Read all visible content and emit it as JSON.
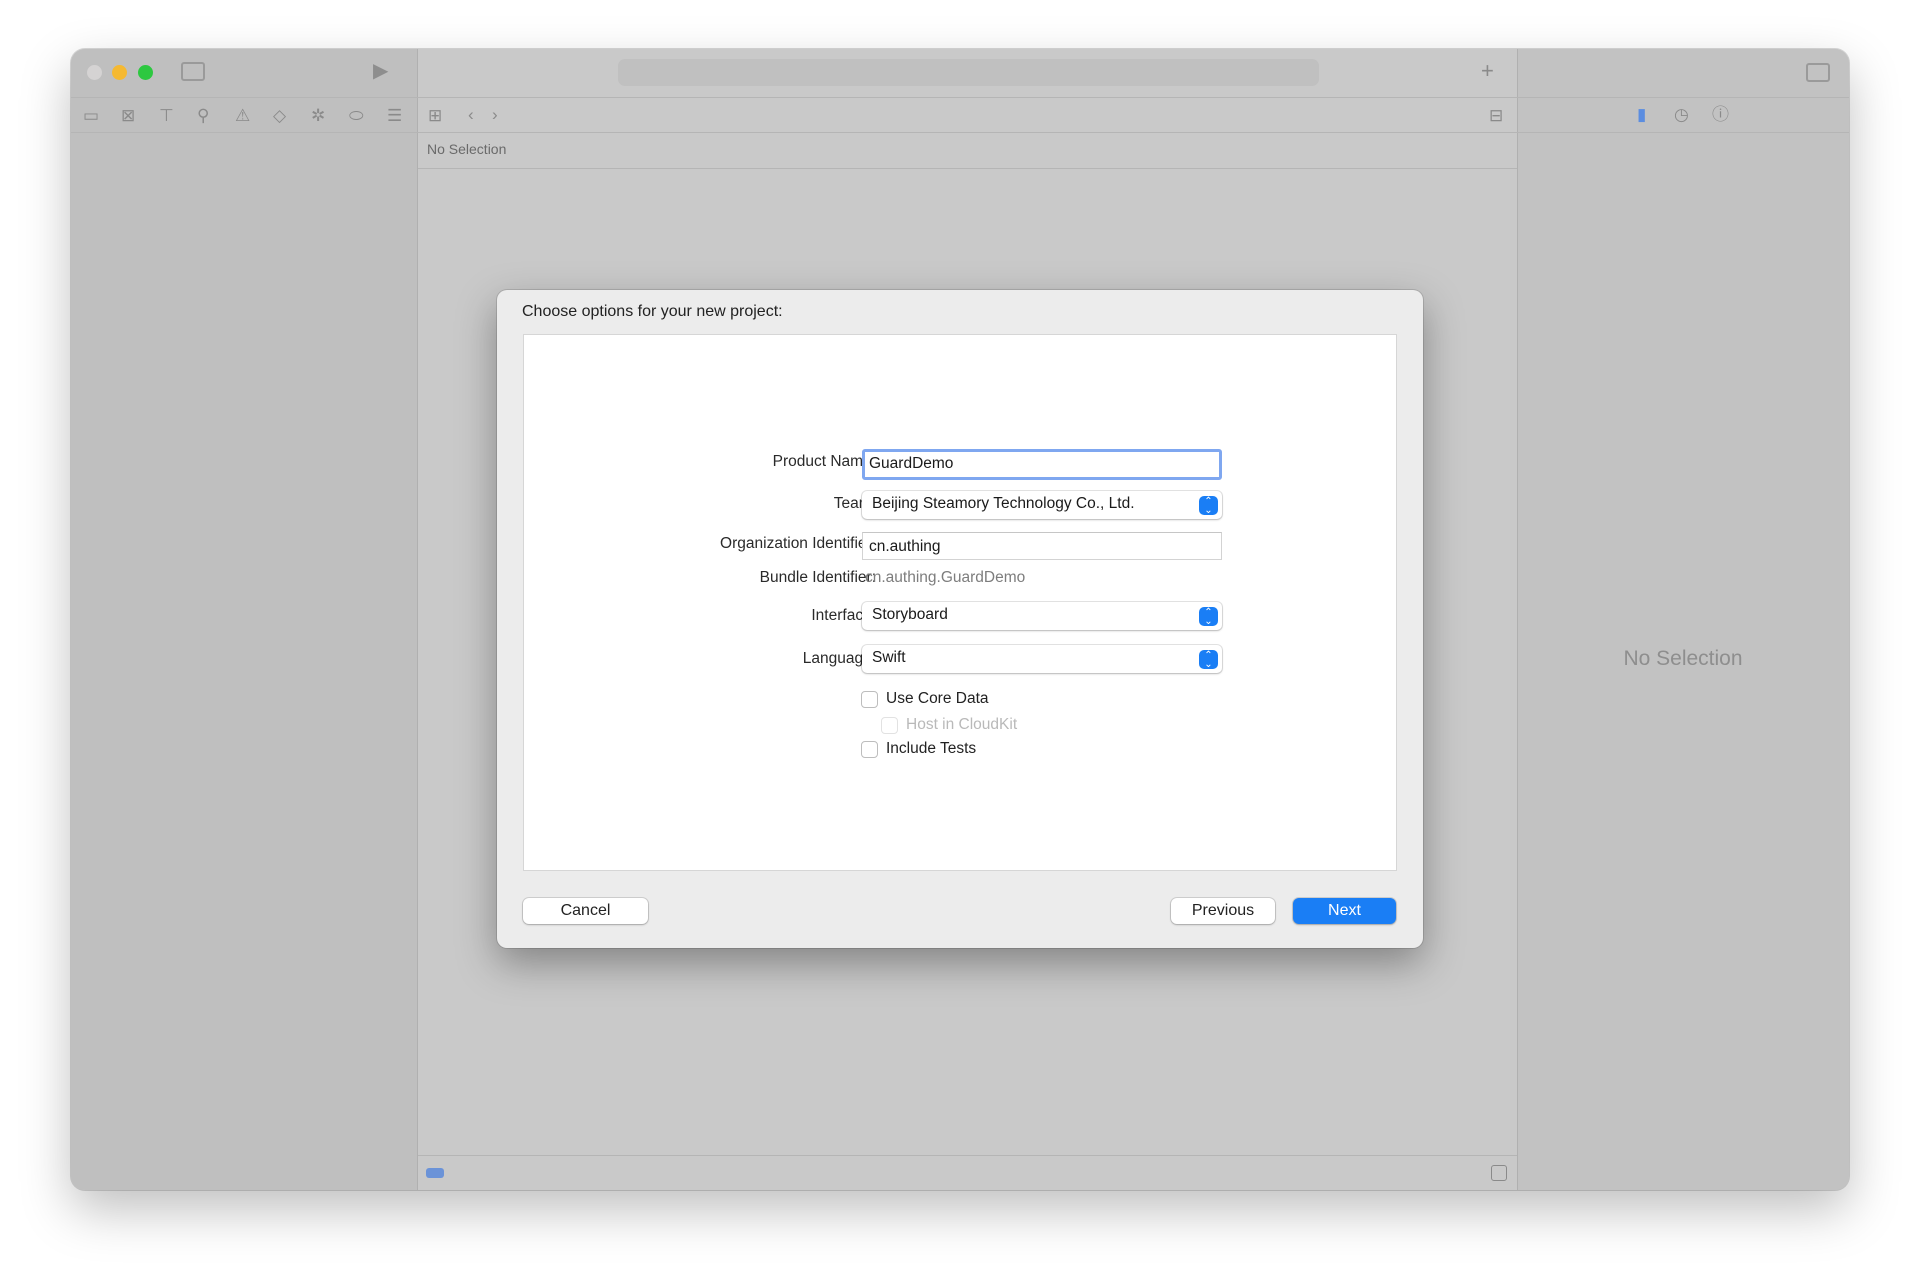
{
  "window": {
    "traffic_lights": {
      "close": "#d5d3d3",
      "minimize": "#f5b932",
      "zoom": "#2dc840"
    },
    "navigator_icons": [
      "folder-icon",
      "source-control-icon",
      "hierarchy-icon",
      "search-icon",
      "warning-icon",
      "test-diamond-icon",
      "debug-spray-icon",
      "breakpoint-icon",
      "report-icon"
    ],
    "editor_path": "No Selection",
    "inspector_placeholder": "No Selection"
  },
  "dialog": {
    "title": "Choose options for your new project:",
    "fields": {
      "product_name": {
        "label": "Product Name:",
        "value": "GuardDemo"
      },
      "team": {
        "label": "Team:",
        "value": "Beijing Steamory Technology Co., Ltd."
      },
      "org_id": {
        "label": "Organization Identifier:",
        "value": "cn.authing"
      },
      "bundle_id": {
        "label": "Bundle Identifier:",
        "value": "cn.authing.GuardDemo"
      },
      "interface": {
        "label": "Interface:",
        "value": "Storyboard"
      },
      "language": {
        "label": "Language:",
        "value": "Swift"
      }
    },
    "checkboxes": {
      "core_data": {
        "label": "Use Core Data",
        "checked": false
      },
      "cloudkit": {
        "label": "Host in CloudKit",
        "checked": false,
        "disabled": true
      },
      "tests": {
        "label": "Include Tests",
        "checked": false
      }
    },
    "buttons": {
      "cancel": "Cancel",
      "previous": "Previous",
      "next": "Next"
    },
    "accent": "#1a7ef5"
  }
}
